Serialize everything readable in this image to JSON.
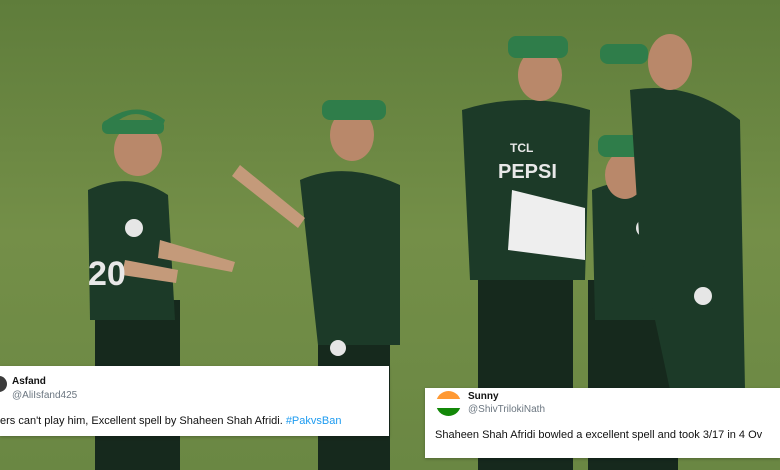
{
  "photo": {
    "grass_color": "#6e8a45",
    "kit_color": "#1c3a28",
    "cap_color": "#2f7d4a",
    "jersey_text": [
      "PEPSI",
      "TCL",
      "20"
    ]
  },
  "tweets": [
    {
      "name": "Asfand",
      "handle": "@AliIsfand425",
      "text": "ers can't play him, Excellent spell by Shaheen Shah Afridi. ",
      "hashtag": "#PakvsBan",
      "avatar_icon": "profile-avatar-icon"
    },
    {
      "name": "Sunny",
      "handle": "@ShivTrilokiNath",
      "text": "Shaheen Shah Afridi bowled a excellent spell and took 3/17 in 4 Ov",
      "avatar_icon": "india-flag-avatar-icon",
      "flag_colors": [
        "#ff9933",
        "#ffffff",
        "#138808"
      ]
    }
  ]
}
